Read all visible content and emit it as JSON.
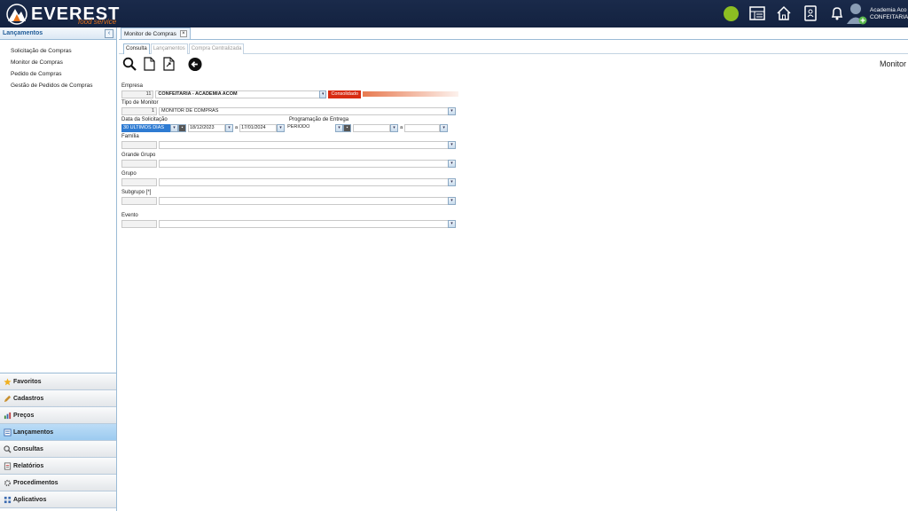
{
  "header": {
    "brand": "EVEREST",
    "brand_sub": "food service",
    "user_name": "Academia Aco",
    "user_company": "CONFEITARIA",
    "icons": [
      "status-dot",
      "grid-icon",
      "home-icon",
      "contact-icon",
      "bell-icon",
      "user-icon"
    ]
  },
  "sidebar": {
    "title": "Lançamentos",
    "items": [
      {
        "label": "Solicitação de Compras"
      },
      {
        "label": "Monitor de Compras"
      },
      {
        "label": "Pedido de Compras"
      },
      {
        "label": "Gestão de Pedidos de Compras"
      }
    ],
    "accordion": [
      {
        "label": "Favoritos",
        "icon": "star-icon"
      },
      {
        "label": "Cadastros",
        "icon": "pencil-icon"
      },
      {
        "label": "Preços",
        "icon": "chart-icon"
      },
      {
        "label": "Lançamentos",
        "icon": "list-icon",
        "active": true
      },
      {
        "label": "Consultas",
        "icon": "magnifier-icon"
      },
      {
        "label": "Relatórios",
        "icon": "report-icon"
      },
      {
        "label": "Procedimentos",
        "icon": "gears-icon"
      },
      {
        "label": "Aplicativos",
        "icon": "apps-icon"
      }
    ]
  },
  "main": {
    "doc_tab": "Monitor de Compras",
    "doc_tab_close": "×",
    "sub_tabs": [
      "Consulta",
      "Lançamentos",
      "Compra Centralizada"
    ],
    "page_title": "Monitor",
    "form": {
      "empresa_label": "Empresa",
      "empresa_code": "11",
      "empresa_value": "CONFEITARIA - ACADEMIA ACOM",
      "consolidado": "Consolidado",
      "tipo_label": "Tipo de Monitor",
      "tipo_code": "1",
      "tipo_value": "MONITOR DE COMPRAS",
      "data_label": "Data da Solicitação",
      "data_period": "30 ULTIMOS DIAS",
      "data_from": "18/12/2023",
      "data_sep": "a",
      "data_to": "17/01/2024",
      "prog_label": "Programação de Entrega",
      "prog_period": "PERIODO",
      "prog_sep": "a",
      "familia_label": "Família",
      "grande_grupo_label": "Grande Grupo",
      "grupo_label": "Grupo",
      "subgrupo_label": "Subgrupo [*]",
      "evento_label": "Evento"
    }
  }
}
